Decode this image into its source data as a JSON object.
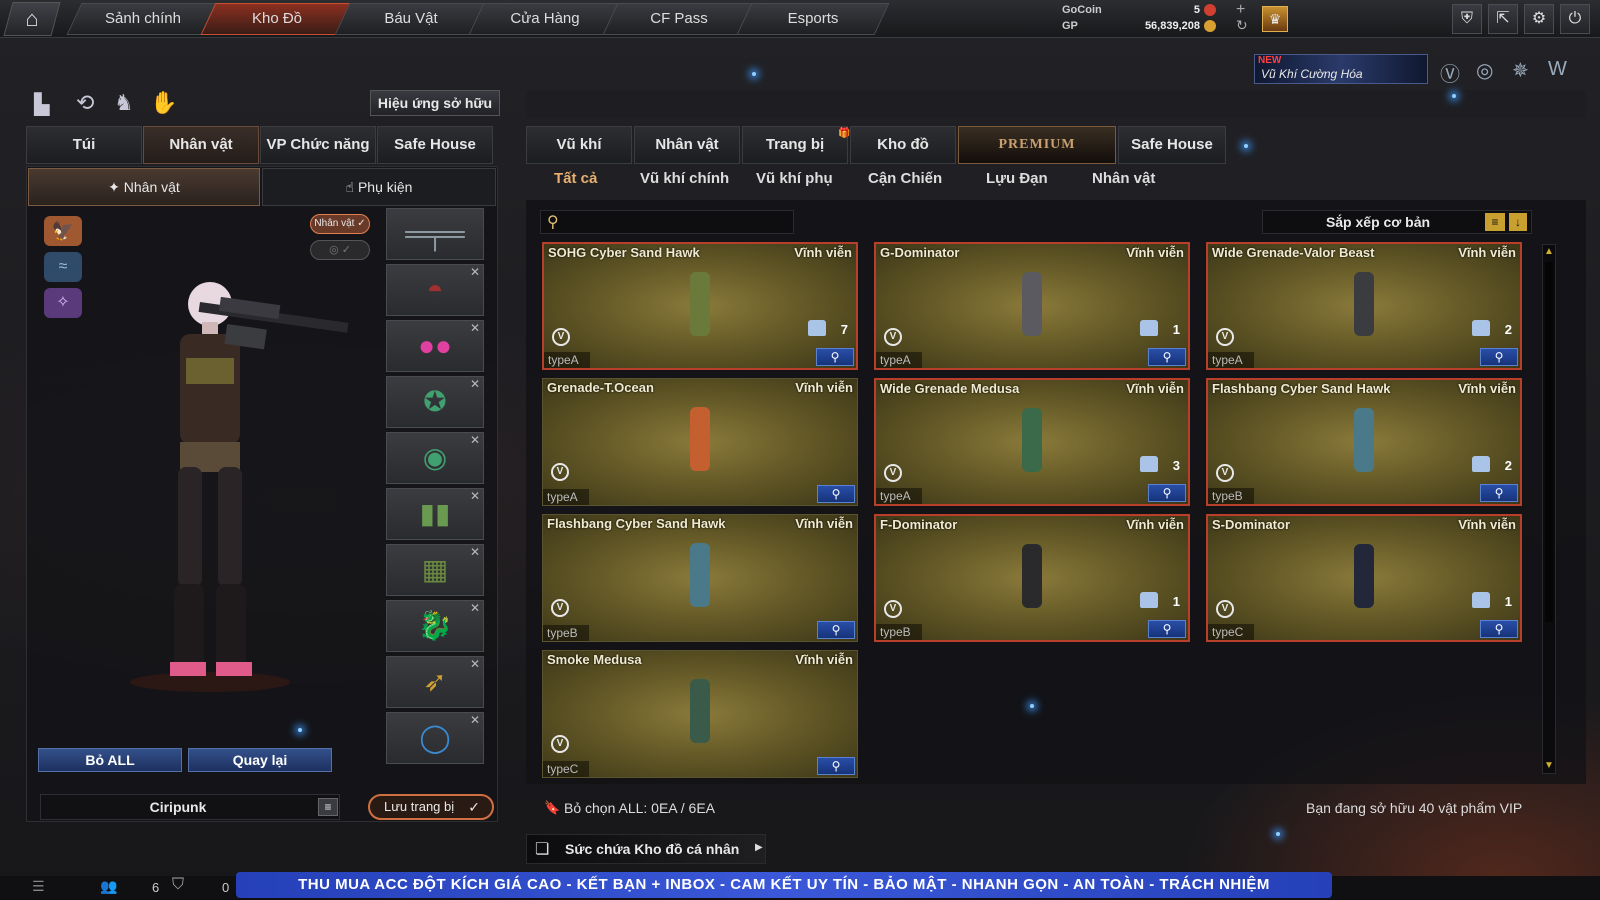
{
  "topnav": {
    "tabs": [
      "Sảnh chính",
      "Kho Đồ",
      "Báu Vật",
      "Cửa Hàng",
      "CF Pass",
      "Esports"
    ],
    "active": "Kho Đồ",
    "gocoin_label": "GoCoin",
    "gocoin_value": "5",
    "gp_label": "GP",
    "gp_value": "56,839,208"
  },
  "banner": {
    "new_label": "NEW",
    "text": "Vũ Khí Cường Hóa"
  },
  "left": {
    "effects_button": "Hiệu ứng sở hữu",
    "tabs": [
      "Túi",
      "Nhân vật",
      "VP Chức năng",
      "Safe House"
    ],
    "active_tab": "Nhân vật",
    "subtabs": [
      "Nhân vật",
      "Phụ kiện"
    ],
    "character_badge": "Nhân vật ✓",
    "remove_all": "Bỏ ALL",
    "back": "Quay lại",
    "character_name": "Ciripunk",
    "save_equip": "Lưu trang bị"
  },
  "right": {
    "tabs": [
      "Vũ khí",
      "Nhân vật",
      "Trang bị",
      "Kho đồ",
      "PREMIUM",
      "Safe House"
    ],
    "active_tab": "PREMIUM",
    "subtabs": [
      "Tất cả",
      "Vũ khí chính",
      "Vũ khí phụ",
      "Cận Chiến",
      "Lựu Đạn",
      "Nhân vật"
    ],
    "active_subtab": "Tất cả",
    "search_placeholder": "",
    "sort_label": "Sắp xếp cơ bản",
    "items": [
      {
        "name": "SOHG Cyber Sand Hawk",
        "duration": "Vĩnh viễn",
        "type": "typeA",
        "count": "7",
        "color": "#6a7a3a"
      },
      {
        "name": "G-Dominator",
        "duration": "Vĩnh viễn",
        "type": "typeA",
        "count": "1",
        "color": "#5a5a60"
      },
      {
        "name": "Wide Grenade-Valor Beast",
        "duration": "Vĩnh viễn",
        "type": "typeA",
        "count": "2",
        "color": "#3a3c40"
      },
      {
        "name": "Grenade-T.Ocean",
        "duration": "Vĩnh viễn",
        "type": "typeA",
        "count": "",
        "color": "#c46030"
      },
      {
        "name": "Wide Grenade Medusa",
        "duration": "Vĩnh viễn",
        "type": "typeA",
        "count": "3",
        "color": "#3a6a4a"
      },
      {
        "name": "Flashbang Cyber Sand Hawk",
        "duration": "Vĩnh viễn",
        "type": "typeB",
        "count": "2",
        "color": "#4a7a8a"
      },
      {
        "name": "Flashbang Cyber Sand Hawk",
        "duration": "Vĩnh viễn",
        "type": "typeB",
        "count": "",
        "color": "#4a7a8a"
      },
      {
        "name": "F-Dominator",
        "duration": "Vĩnh viễn",
        "type": "typeB",
        "count": "1",
        "color": "#2a2a2c"
      },
      {
        "name": "S-Dominator",
        "duration": "Vĩnh viễn",
        "type": "typeC",
        "count": "1",
        "color": "#22283a"
      },
      {
        "name": "Smoke Medusa",
        "duration": "Vĩnh viễn",
        "type": "typeC",
        "count": "",
        "color": "#3a5a4a"
      }
    ],
    "deselect_all": "Bỏ chọn ALL: 0EA / 6EA",
    "vip_status": "Bạn đang sở hữu 40 vật phẩm VIP",
    "capacity": "Sức chứa Kho đồ cá nhân"
  },
  "bottombar": {
    "count_a": "6",
    "count_b": "0",
    "ticker": "THU MUA ACC ĐỘT KÍCH GIÁ CAO  -  KẾT BẠN + INBOX  -  CAM KẾT UY TÍN - BẢO MẬT - NHANH GỌN - AN TOÀN - TRÁCH NHIỆM"
  }
}
